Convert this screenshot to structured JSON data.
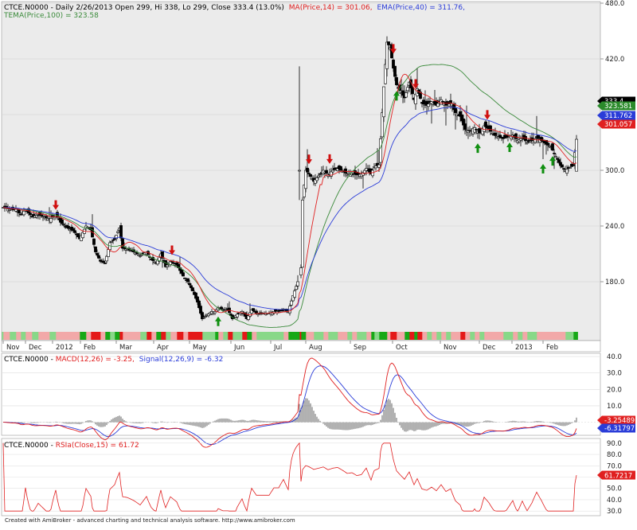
{
  "colors": {
    "panel_bg": "#ebebeb",
    "bull_candle": "#ffffff",
    "bear_candle": "#000000",
    "ma": "#e02020",
    "ema": "#2a3cd8",
    "tema": "#3a8a3a",
    "macd": "#e02020",
    "signal": "#2a3cd8",
    "rsi": "#e02020",
    "strip_red": "#e41818",
    "strip_pink": "#f2a8a8",
    "strip_green": "#17a817",
    "strip_lightgreen": "#88d888",
    "arrow_up": "#108f10",
    "arrow_down": "#d01010"
  },
  "price_panel": {
    "title": "CTCE.N0000 - Daily 2/26/2013 Open 299, Hi 338, Lo 299, Close 333.4 (13.0%)",
    "ma_label": "MA(Price,14) = 301.06,",
    "ema_label": "EMA(Price,40) = 311.76,",
    "tema_label": "TEMA(Price,100) = 323.58",
    "y_ticks": [
      "480.0",
      "420.0",
      "360.0",
      "300.0",
      "240.0",
      "180.0"
    ],
    "y_tick_values": [
      480,
      420,
      360,
      300,
      240,
      180
    ],
    "badges": [
      {
        "text": "333.4",
        "color": "#000000",
        "value": 333.4
      },
      {
        "text": "323.581",
        "color": "#2a8a2a",
        "value": 323.581
      },
      {
        "text": "311.762",
        "color": "#2a3cd8",
        "value": 311.762
      },
      {
        "text": "301.057",
        "color": "#e02020",
        "value": 301.057
      }
    ],
    "x_labels": [
      "Nov",
      "Dec",
      "2012",
      "Feb",
      "Mar",
      "Apr",
      "May",
      "Jun",
      "Jul",
      "Aug",
      "Sep",
      "Oct",
      "Nov",
      "Dec",
      "2013",
      "Feb"
    ]
  },
  "macd_panel": {
    "title_prefix": "CTCE.N0000 - ",
    "macd_label": "MACD(12,26) = -3.25,",
    "signal_label": "Signal(12,26,9) = -6.32",
    "y_ticks": [
      "40.0",
      "30.0",
      "20.0",
      "10.0",
      "0.0"
    ],
    "y_tick_values": [
      40,
      30,
      20,
      10,
      0
    ],
    "badges": [
      {
        "text": "-3.25489",
        "color": "#e02020",
        "value": -3.25
      },
      {
        "text": "-6.31797",
        "color": "#2a3cd8",
        "value": -6.32
      }
    ]
  },
  "rsi_panel": {
    "title_prefix": "CTCE.N0000 - ",
    "rsi_label": "RSIa(Close,15) = 61.72",
    "y_ticks": [
      "90.0",
      "80.0",
      "70.0",
      "60.0",
      "50.0",
      "40.0",
      "30.0"
    ],
    "y_tick_values": [
      90,
      80,
      70,
      60,
      50,
      40,
      30
    ],
    "badges": [
      {
        "text": "61.7217",
        "color": "#e02020",
        "value": 61.72
      }
    ]
  },
  "footer": "Created with AmiBroker - advanced charting and technical analysis software. http://www.amibroker.com",
  "chart_data": {
    "type": "candlestick",
    "anchors": [
      [
        0,
        260
      ],
      [
        8,
        258
      ],
      [
        16,
        258
      ],
      [
        22,
        252
      ],
      [
        28,
        258
      ],
      [
        36,
        250
      ],
      [
        44,
        252
      ],
      [
        52,
        250
      ],
      [
        58,
        247
      ],
      [
        66,
        252
      ],
      [
        72,
        244
      ],
      [
        80,
        238
      ],
      [
        88,
        235
      ],
      [
        96,
        226
      ],
      [
        104,
        240
      ],
      [
        110,
        236
      ],
      [
        116,
        212
      ],
      [
        122,
        202
      ],
      [
        128,
        200
      ],
      [
        134,
        222
      ],
      [
        140,
        226
      ],
      [
        146,
        238
      ],
      [
        150,
        216
      ],
      [
        156,
        215
      ],
      [
        164,
        212
      ],
      [
        172,
        208
      ],
      [
        180,
        212
      ],
      [
        186,
        204
      ],
      [
        192,
        200
      ],
      [
        198,
        210
      ],
      [
        204,
        196
      ],
      [
        210,
        202
      ],
      [
        218,
        198
      ],
      [
        226,
        186
      ],
      [
        232,
        180
      ],
      [
        238,
        170
      ],
      [
        244,
        158
      ],
      [
        250,
        140
      ],
      [
        256,
        144
      ],
      [
        262,
        148
      ],
      [
        266,
        148
      ],
      [
        270,
        152
      ],
      [
        276,
        150
      ],
      [
        282,
        150
      ],
      [
        288,
        140
      ],
      [
        294,
        145
      ],
      [
        300,
        148
      ],
      [
        306,
        140
      ],
      [
        312,
        150
      ],
      [
        318,
        146
      ],
      [
        326,
        146
      ],
      [
        334,
        146
      ],
      [
        340,
        148
      ],
      [
        346,
        148
      ],
      [
        352,
        150
      ],
      [
        358,
        148
      ],
      [
        364,
        165
      ],
      [
        370,
        180
      ],
      [
        374,
        195
      ],
      [
        376,
        268
      ],
      [
        380,
        300
      ],
      [
        384,
        296
      ],
      [
        390,
        288
      ],
      [
        396,
        294
      ],
      [
        402,
        300
      ],
      [
        408,
        295
      ],
      [
        414,
        300
      ],
      [
        420,
        302
      ],
      [
        426,
        299
      ],
      [
        432,
        296
      ],
      [
        438,
        297
      ],
      [
        444,
        295
      ],
      [
        450,
        296
      ],
      [
        456,
        302
      ],
      [
        462,
        296
      ],
      [
        466,
        304
      ],
      [
        472,
        306
      ],
      [
        478,
        390
      ],
      [
        482,
        438
      ],
      [
        486,
        432
      ],
      [
        490,
        410
      ],
      [
        494,
        392
      ],
      [
        498,
        386
      ],
      [
        504,
        378
      ],
      [
        510,
        395
      ],
      [
        516,
        376
      ],
      [
        520,
        388
      ],
      [
        526,
        372
      ],
      [
        532,
        370
      ],
      [
        538,
        374
      ],
      [
        544,
        370
      ],
      [
        550,
        376
      ],
      [
        556,
        370
      ],
      [
        562,
        372
      ],
      [
        568,
        362
      ],
      [
        574,
        358
      ],
      [
        580,
        344
      ],
      [
        586,
        342
      ],
      [
        592,
        346
      ],
      [
        598,
        340
      ],
      [
        604,
        348
      ],
      [
        610,
        344
      ],
      [
        616,
        338
      ],
      [
        622,
        336
      ],
      [
        628,
        334
      ],
      [
        634,
        336
      ],
      [
        640,
        338
      ],
      [
        646,
        332
      ],
      [
        652,
        335
      ],
      [
        658,
        330
      ],
      [
        664,
        332
      ],
      [
        670,
        335
      ],
      [
        676,
        332
      ],
      [
        682,
        328
      ],
      [
        688,
        325
      ],
      [
        694,
        315
      ],
      [
        700,
        305
      ],
      [
        706,
        300
      ],
      [
        710,
        302
      ],
      [
        716,
        305
      ],
      [
        720,
        333.4
      ]
    ],
    "ma_last": 301.06,
    "ema_last": 311.76,
    "tema_last": 323.58,
    "macd_last": -3.25,
    "signal_last": -6.32,
    "rsi_last": 61.72,
    "up_arrow_bars": [
      270,
      494,
      596,
      636,
      678,
      690
    ],
    "down_arrow_bars": [
      66,
      212,
      384,
      410,
      490,
      518,
      608
    ],
    "ylim_price": [
      120,
      480
    ],
    "ylim_macd": [
      -6.5,
      41
    ],
    "ylim_rsi": [
      28,
      92
    ]
  }
}
